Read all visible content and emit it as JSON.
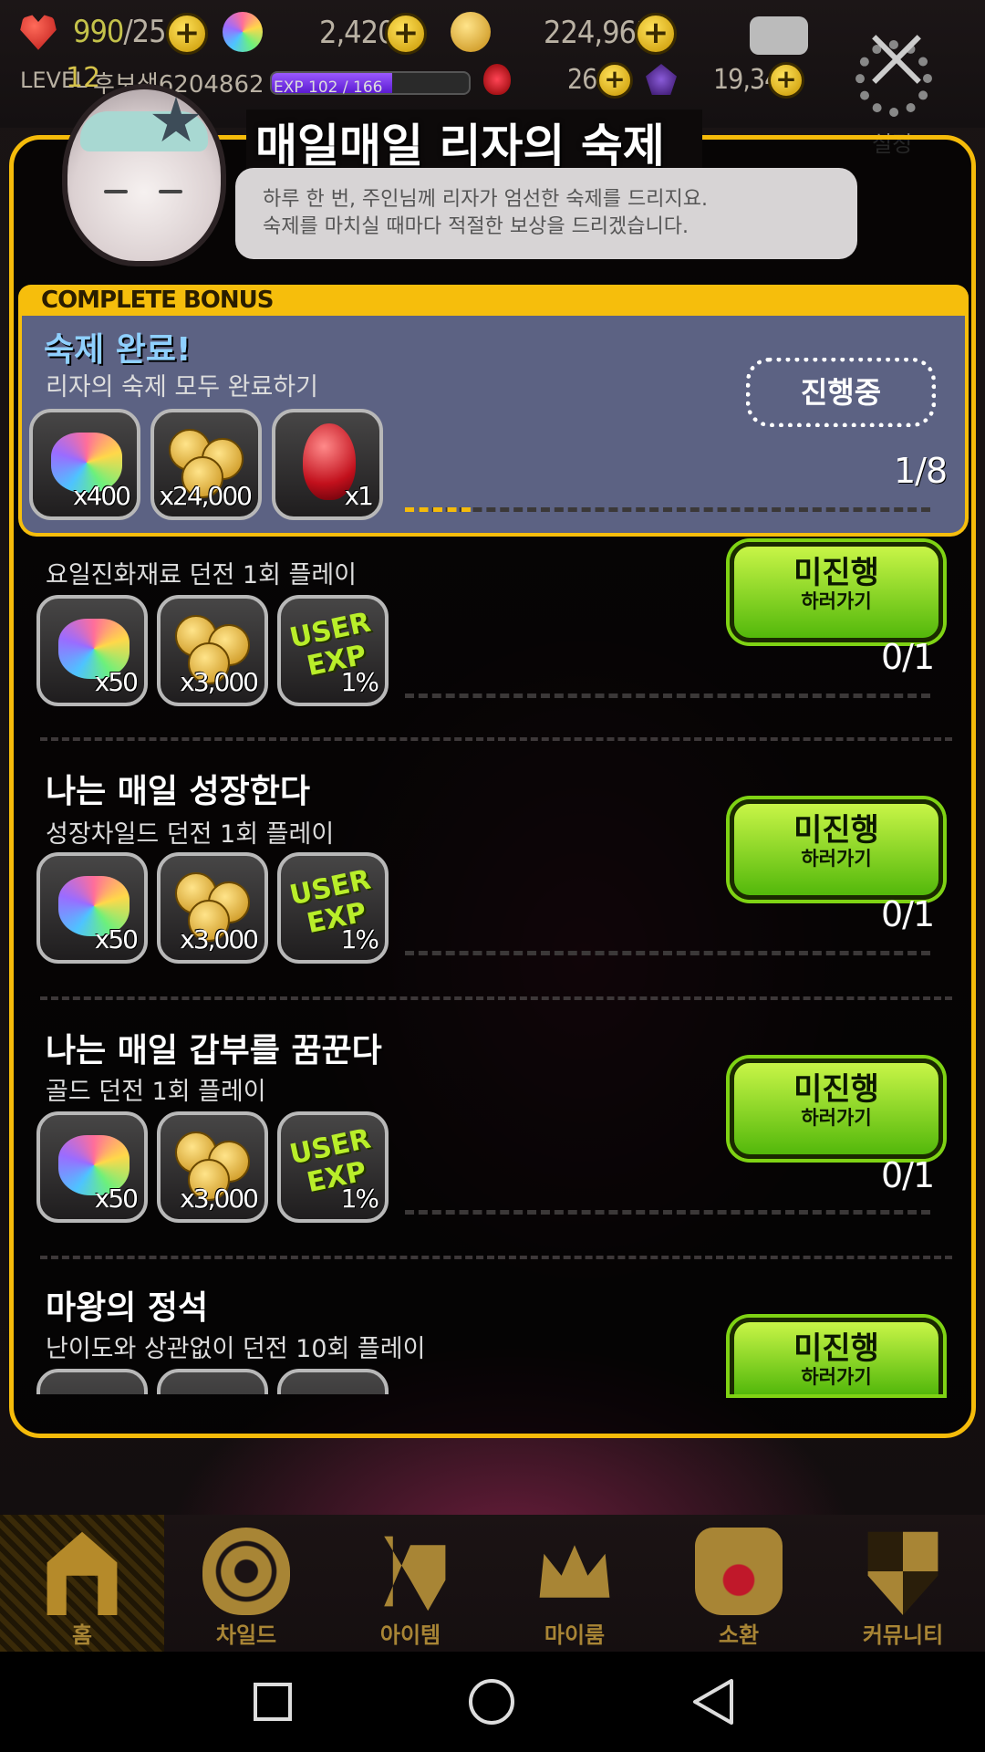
{
  "topbar": {
    "hearts": "990",
    "hearts_max": "/25",
    "gems": "2,420",
    "gold": "224,963",
    "level_label": "LEVEL",
    "level": "12",
    "player_name": "후보생6204862",
    "exp_label": "EXP 102 / 166",
    "exp_fraction": 0.61,
    "ruby_count": "26",
    "soul_count": "19,340",
    "settings_label": "설정"
  },
  "panel": {
    "title": "매일매일 리자의 숙제",
    "bubble_line1": "하루 한 번, 주인님께 리자가 엄선한 숙제를 드리지요.",
    "bubble_line2": "숙제를 마치실 때마다 적절한 보상을 드리겠습니다."
  },
  "complete_bonus": {
    "header": "COMPLETE BONUS",
    "title": "숙제 완료!",
    "subtitle": "리자의 숙제 모두 완료하기",
    "status": "진행중",
    "progress": "1/8",
    "progress_fraction": 0.125,
    "rewards": [
      {
        "icon": "rainbow-gem-icon",
        "qty": "x400"
      },
      {
        "icon": "gold-coins-icon",
        "qty": "x24,000"
      },
      {
        "icon": "ruby-icon",
        "qty": "x1"
      }
    ]
  },
  "quests": [
    {
      "title": "",
      "subtitle": "요일진화재료 던전 1회 플레이",
      "btn_main": "미진행",
      "btn_sub": "하러가기",
      "progress": "0/1",
      "rewards": [
        {
          "qty": "x50"
        },
        {
          "qty": "x3,000"
        },
        {
          "exp": "USER EXP",
          "qty": "1%"
        }
      ]
    },
    {
      "title": "나는 매일 성장한다",
      "subtitle": "성장차일드 던전 1회 플레이",
      "btn_main": "미진행",
      "btn_sub": "하러가기",
      "progress": "0/1",
      "rewards": [
        {
          "qty": "x50"
        },
        {
          "qty": "x3,000"
        },
        {
          "exp": "USER EXP",
          "qty": "1%"
        }
      ]
    },
    {
      "title": "나는 매일 갑부를 꿈꾼다",
      "subtitle": "골드 던전 1회 플레이",
      "btn_main": "미진행",
      "btn_sub": "하러가기",
      "progress": "0/1",
      "rewards": [
        {
          "qty": "x50"
        },
        {
          "qty": "x3,000"
        },
        {
          "exp": "USER EXP",
          "qty": "1%"
        }
      ]
    },
    {
      "title": "마왕의 정석",
      "subtitle": "난이도와 상관없이 던전 10회 플레이",
      "btn_main": "미진행",
      "btn_sub": "하러가기"
    }
  ],
  "nav": [
    {
      "label": "홈",
      "icon": "home-arch-icon"
    },
    {
      "label": "차일드",
      "icon": "flame-eye-icon"
    },
    {
      "label": "아이템",
      "icon": "sword-shield-icon"
    },
    {
      "label": "마이룸",
      "icon": "crown-laurel-icon"
    },
    {
      "label": "소환",
      "icon": "potion-heart-icon"
    },
    {
      "label": "커뮤니티",
      "icon": "checkered-shield-icon"
    }
  ],
  "colors": {
    "accent": "#f5bb0a",
    "go_button": "#7fd314",
    "bonus_box": "#5c6283",
    "nav_label": "#a88535"
  }
}
